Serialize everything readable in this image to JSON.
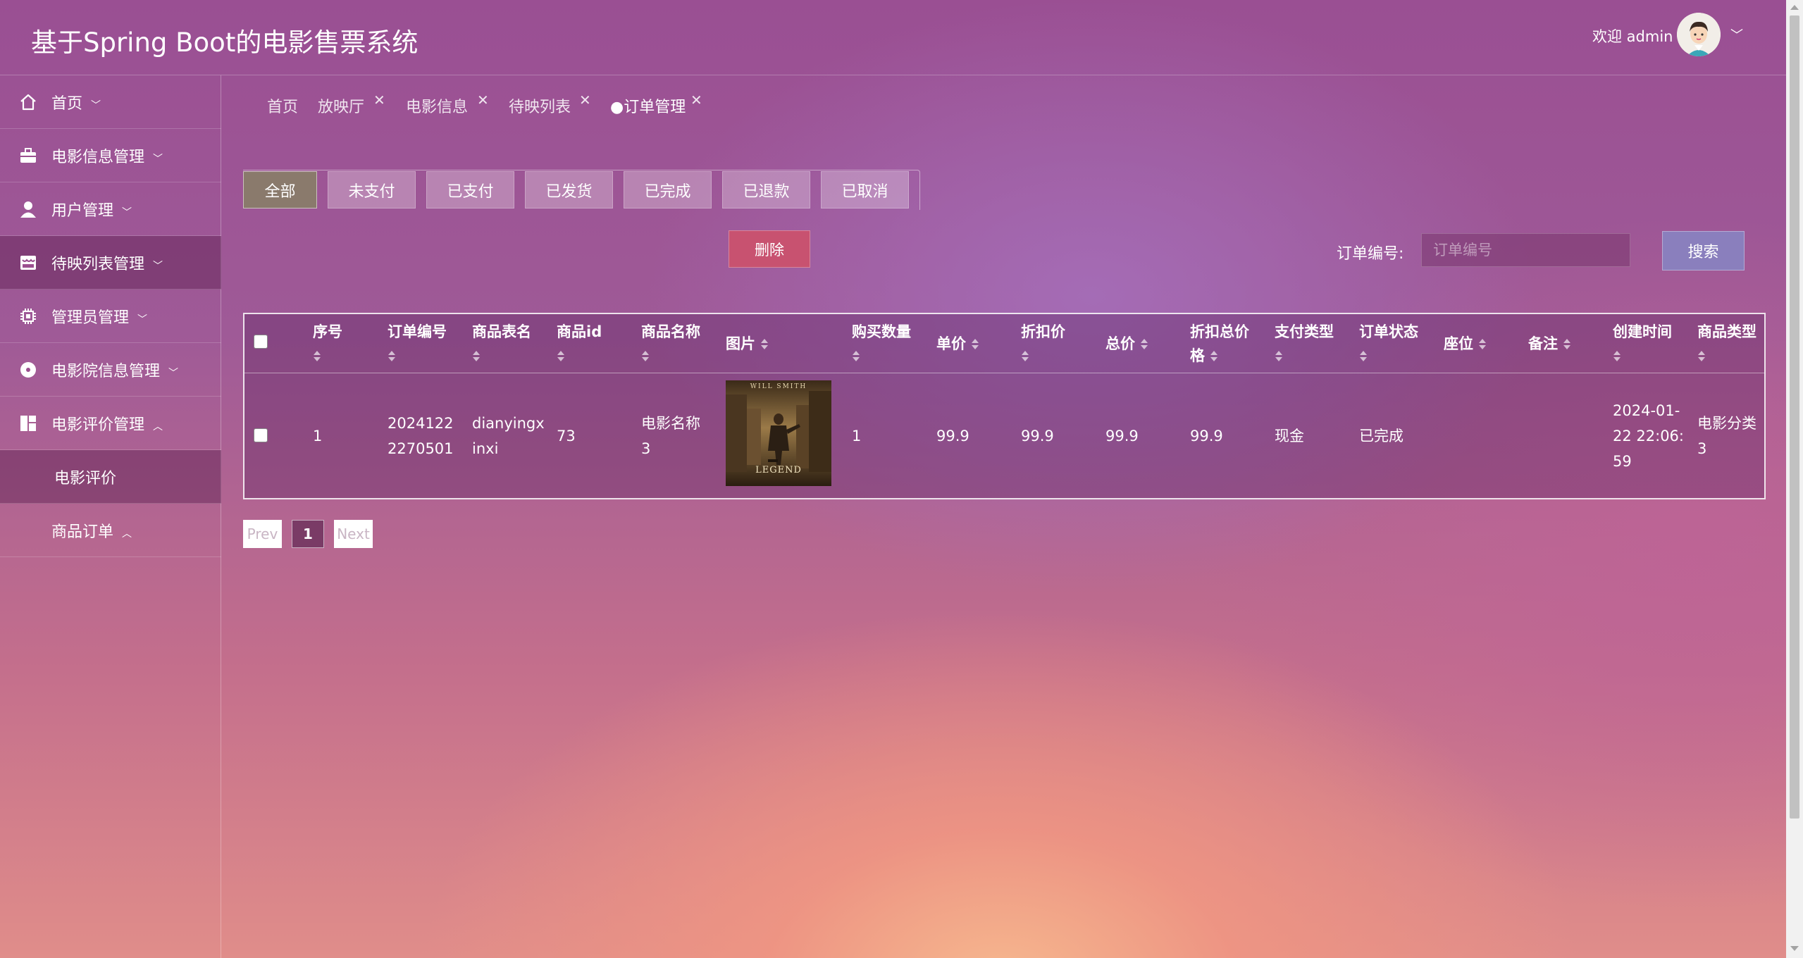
{
  "header": {
    "app_title": "基于Spring Boot的电影售票系统",
    "welcome": "欢迎 admin",
    "user_caret": "﹀"
  },
  "sidebar": {
    "items": [
      {
        "label": "首页",
        "caret": "﹀",
        "icon": "home-icon"
      },
      {
        "label": "电影信息管理",
        "caret": "﹀",
        "icon": "briefcase-icon"
      },
      {
        "label": "用户管理",
        "caret": "﹀",
        "icon": "user-icon"
      },
      {
        "label": "待映列表管理",
        "caret": "﹀",
        "icon": "store-icon"
      },
      {
        "label": "管理员管理",
        "caret": "﹀",
        "icon": "chip-icon"
      },
      {
        "label": "电影院信息管理",
        "caret": "﹀",
        "icon": "disc-icon"
      },
      {
        "label": "电影评价管理",
        "caret": "︿",
        "icon": "dashboard-icon"
      }
    ],
    "sub_items": [
      {
        "label": "电影评价"
      },
      {
        "label": "商品订单",
        "caret": "︿"
      }
    ]
  },
  "tabs": [
    {
      "label": "首页"
    },
    {
      "label": "放映厅",
      "close": "✕"
    },
    {
      "label": "电影信息",
      "close": "✕"
    },
    {
      "label": "待映列表",
      "close": "✕"
    },
    {
      "label": "●订单管理",
      "close": "✕"
    }
  ],
  "status_filters": [
    "全部",
    "未支付",
    "已支付",
    "已发货",
    "已完成",
    "已退款",
    "已取消"
  ],
  "active_status": "全部",
  "toolbar": {
    "delete_label": "删除",
    "search_label": "订单编号:",
    "search_placeholder": "订单编号",
    "search_value": "",
    "search_button": "搜索"
  },
  "table": {
    "headers": [
      "序号",
      "订单编号",
      "商品表名",
      "商品id",
      "商品名称",
      "图片",
      "购买数量",
      "单价",
      "折扣价",
      "总价",
      "折扣总价格",
      "支付类型",
      "订单状态",
      "座位",
      "备注",
      "创建时间",
      "商品类型"
    ],
    "rows": [
      {
        "index": "1",
        "order_no_1": "2024122",
        "order_no_2": "2270501",
        "table_name_1": "dianyingx",
        "table_name_2": "inxi",
        "goods_id": "73",
        "goods_name_1": "电影名称",
        "goods_name_2": "3",
        "poster_alt": "LEGEND",
        "poster_top": "WILL SMITH",
        "quantity": "1",
        "unit_price": "99.9",
        "discount_price": "99.9",
        "total_price": "99.9",
        "discount_total": "99.9",
        "pay_type": "现金",
        "status": "已完成",
        "seat": "",
        "remark": "",
        "created_1": "2024-01-",
        "created_2": "22 22:06:",
        "created_3": "59",
        "goods_type_1": "电影分类",
        "goods_type_2": "3"
      }
    ]
  },
  "pagination": {
    "prev": "Prev",
    "current": "1",
    "next": "Next"
  }
}
